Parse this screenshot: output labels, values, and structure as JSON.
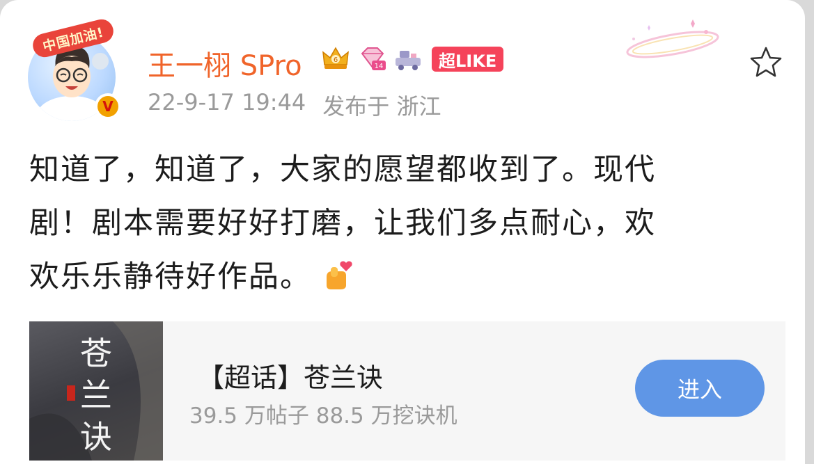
{
  "post": {
    "author": {
      "name": "王一栩 SPro",
      "avatar_banner": "中国加油!",
      "verified_mark": "V"
    },
    "badges": [
      {
        "icon": "crown-level-6-icon"
      },
      {
        "icon": "diamond-level-14-icon"
      },
      {
        "icon": "vehicle-icon"
      }
    ],
    "super_like_label": "超LIKE",
    "timestamp": "22-9-17 19:44",
    "location": "发布于 浙江",
    "text_lines": [
      "知道了，知道了，大家的愿望都收到了。现代",
      "剧！剧本需要好好打磨，让我们多点耐心，欢",
      "欢乐乐静待好作品。"
    ],
    "emoji": "heart-hand-emoji-icon",
    "favorite_icon": "star-outline-icon"
  },
  "topic": {
    "title": "【超话】苍兰诀",
    "stats": "39.5 万帖子 88.5 万挖诀机",
    "cover_text": "苍兰诀",
    "enter_label": "进入"
  },
  "colors": {
    "username": "#f0642a",
    "meta": "#9a9a9a",
    "super_like": "#f5435a",
    "enter_button": "#5f96e6",
    "text": "#1c1c1c"
  }
}
